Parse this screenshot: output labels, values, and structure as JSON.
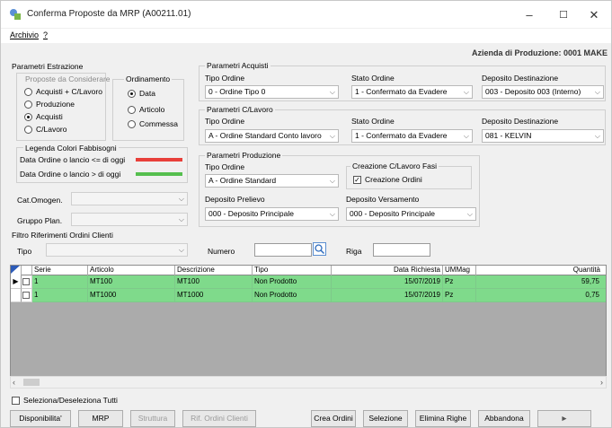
{
  "window": {
    "title": "Conferma Proposte da MRP (A00211.01)",
    "minimize": "–",
    "maximize": "☐",
    "close": "✕"
  },
  "menu": {
    "archivio": "Archivio",
    "help": "?"
  },
  "company": "Azienda di Produzione: 0001 MAKE",
  "estrazione": {
    "title": "Parametri Estrazione",
    "proposte_title": "Proposte da Considerare",
    "proposte_options": [
      "Acquisti + C/Lavoro",
      "Produzione",
      "Acquisti",
      "C/Lavoro"
    ],
    "proposte_selected": "Acquisti",
    "ordinamento_title": "Ordinamento",
    "ordinamento_options": [
      "Data",
      "Articolo",
      "Commessa"
    ],
    "ordinamento_selected": "Data",
    "legenda_title": "Legenda Colori Fabbisogni",
    "legenda_red": "Data Ordine o lancio <= di oggi",
    "legenda_green": "Data Ordine o lancio > di oggi",
    "color_red": "#e8403a",
    "color_green": "#55bf4e",
    "cat_omogen_label": "Cat.Omogen.",
    "gruppo_plan_label": "Gruppo Plan."
  },
  "acquisti": {
    "title": "Parametri Acquisti",
    "tipo_ordine_label": "Tipo Ordine",
    "tipo_ordine_value": "0 - Ordine Tipo 0",
    "stato_ordine_label": "Stato Ordine",
    "stato_ordine_value": "1 - Confermato da Evadere",
    "deposito_label": "Deposito Destinazione",
    "deposito_value": "003 - Deposito 003 (Interno)"
  },
  "clavoro": {
    "title": "Parametri C/Lavoro",
    "tipo_ordine_label": "Tipo Ordine",
    "tipo_ordine_value": "A - Ordine Standard Conto lavoro",
    "stato_ordine_label": "Stato Ordine",
    "stato_ordine_value": "1 - Confermato da Evadere",
    "deposito_label": "Deposito Destinazione",
    "deposito_value": "081 - KELVIN"
  },
  "produzione": {
    "title": "Parametri Produzione",
    "tipo_ordine_label": "Tipo Ordine",
    "tipo_ordine_value": "A - Ordine Standard",
    "creazione_title": "Creazione C/Lavoro Fasi",
    "creazione_checkbox": "Creazione Ordini",
    "creazione_checked": true,
    "prelievo_label": "Deposito Prelievo",
    "prelievo_value": "000 - Deposito Principale",
    "versamento_label": "Deposito Versamento",
    "versamento_value": "000 - Deposito Principale"
  },
  "filtro": {
    "title": "Filtro Riferimenti Ordini Clienti",
    "tipo_label": "Tipo",
    "numero_label": "Numero",
    "riga_label": "Riga"
  },
  "grid": {
    "headers": [
      "Serie",
      "Articolo",
      "Descrizione",
      "Tipo",
      "Data Richiesta",
      "UMMag",
      "Quantità"
    ],
    "rows": [
      {
        "serie": "1",
        "articolo": "MT100",
        "descrizione": "MT100",
        "tipo": "Non Prodotto",
        "data": "15/07/2019",
        "um": "Pz",
        "quantita": "59,75"
      },
      {
        "serie": "1",
        "articolo": "MT1000",
        "descrizione": "MT1000",
        "tipo": "Non Prodotto",
        "data": "15/07/2019",
        "um": "Pz",
        "quantita": "0,75"
      }
    ],
    "row_color": "#7fda8b"
  },
  "select_all": "Seleziona/Deseleziona Tutti",
  "buttons": {
    "disponibilita": "Disponibilita'",
    "mrp": "MRP",
    "struttura": "Struttura",
    "rif_ordini": "Rif. Ordini Clienti",
    "crea_ordini": "Crea Ordini",
    "selezione": "Selezione",
    "elimina_righe": "Elimina Righe",
    "abbandona": "Abbandona",
    "next": "►"
  }
}
